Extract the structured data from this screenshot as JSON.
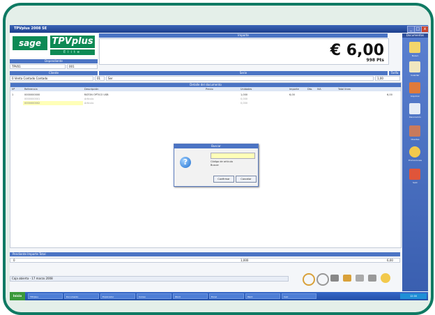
{
  "window": {
    "title": "TPVplus 2008 SE"
  },
  "logo": {
    "brand": "sage",
    "product": "TPVplus",
    "edition": "Elite"
  },
  "header": {
    "importe_label": "Importe",
    "total_euros": "€ 6,00",
    "total_pts": "998 Pts",
    "dependiente_label": "Dependiente",
    "dependiente_code": "TPV01",
    "dependiente_num": "001",
    "cliente_label": "Cliente",
    "cliente_value": "0  Venta Contado Contado",
    "cliente_num": "01",
    "serie_label": "Serie",
    "serie_value": "Ser",
    "tarifa_label": "Tarifa",
    "tarifa_value": "1,00"
  },
  "grid": {
    "title": "Detalle del documento",
    "columns": [
      "Nº",
      "Referencia",
      "Descripción",
      "Precio",
      "Unidades",
      "Importe",
      "Dto.",
      "IVA",
      "Total línea"
    ],
    "rows": [
      {
        "num": "1",
        "ref": "0000000000",
        "desc": "RATON ÓPTICO USB",
        "units": "1,000",
        "price": "6,00",
        "total": "6,00"
      },
      {
        "num": "",
        "ref": "0000000001",
        "desc": "Articulo",
        "units": "0,000",
        "price": "",
        "total": ""
      },
      {
        "num": "",
        "ref": "0000000002",
        "desc": "Articulo",
        "units": "0,000",
        "price": "",
        "total": ""
      }
    ]
  },
  "dialog": {
    "title": "Buscar",
    "message_line1": "Código de artículo",
    "message_line2": "Buscar",
    "ok_label": "Confirmar",
    "cancel_label": "Cancelar"
  },
  "footer": {
    "totals_header": "Pendiente   Importe   Total",
    "status_text": "Caja abierta - 17 marzo 2008",
    "pend": "0",
    "units": "1,000",
    "total": "6,00"
  },
  "sidebar": {
    "title": "Documentos",
    "items": [
      {
        "label": "Nuevo",
        "icon": "new-doc-icon"
      },
      {
        "label": "Guardar",
        "icon": "save-icon"
      },
      {
        "label": "Imprimir",
        "icon": "print-icon"
      },
      {
        "label": "Devolución",
        "icon": "return-icon"
      },
      {
        "label": "Clientes",
        "icon": "client-icon"
      },
      {
        "label": "Promociones",
        "icon": "promo-icon"
      },
      {
        "label": "Salir",
        "icon": "exit-icon"
      }
    ]
  },
  "taskbar": {
    "start_label": "Inicio",
    "items": [
      "TPVplus",
      "Documento",
      "Explorador",
      "Correo",
      "Word",
      "Excel",
      "Paint",
      "Calc"
    ],
    "clock": "12:00"
  },
  "colors": {
    "frame": "#0f7a63",
    "header": "#4b74c4",
    "brand": "#0d8a55"
  }
}
